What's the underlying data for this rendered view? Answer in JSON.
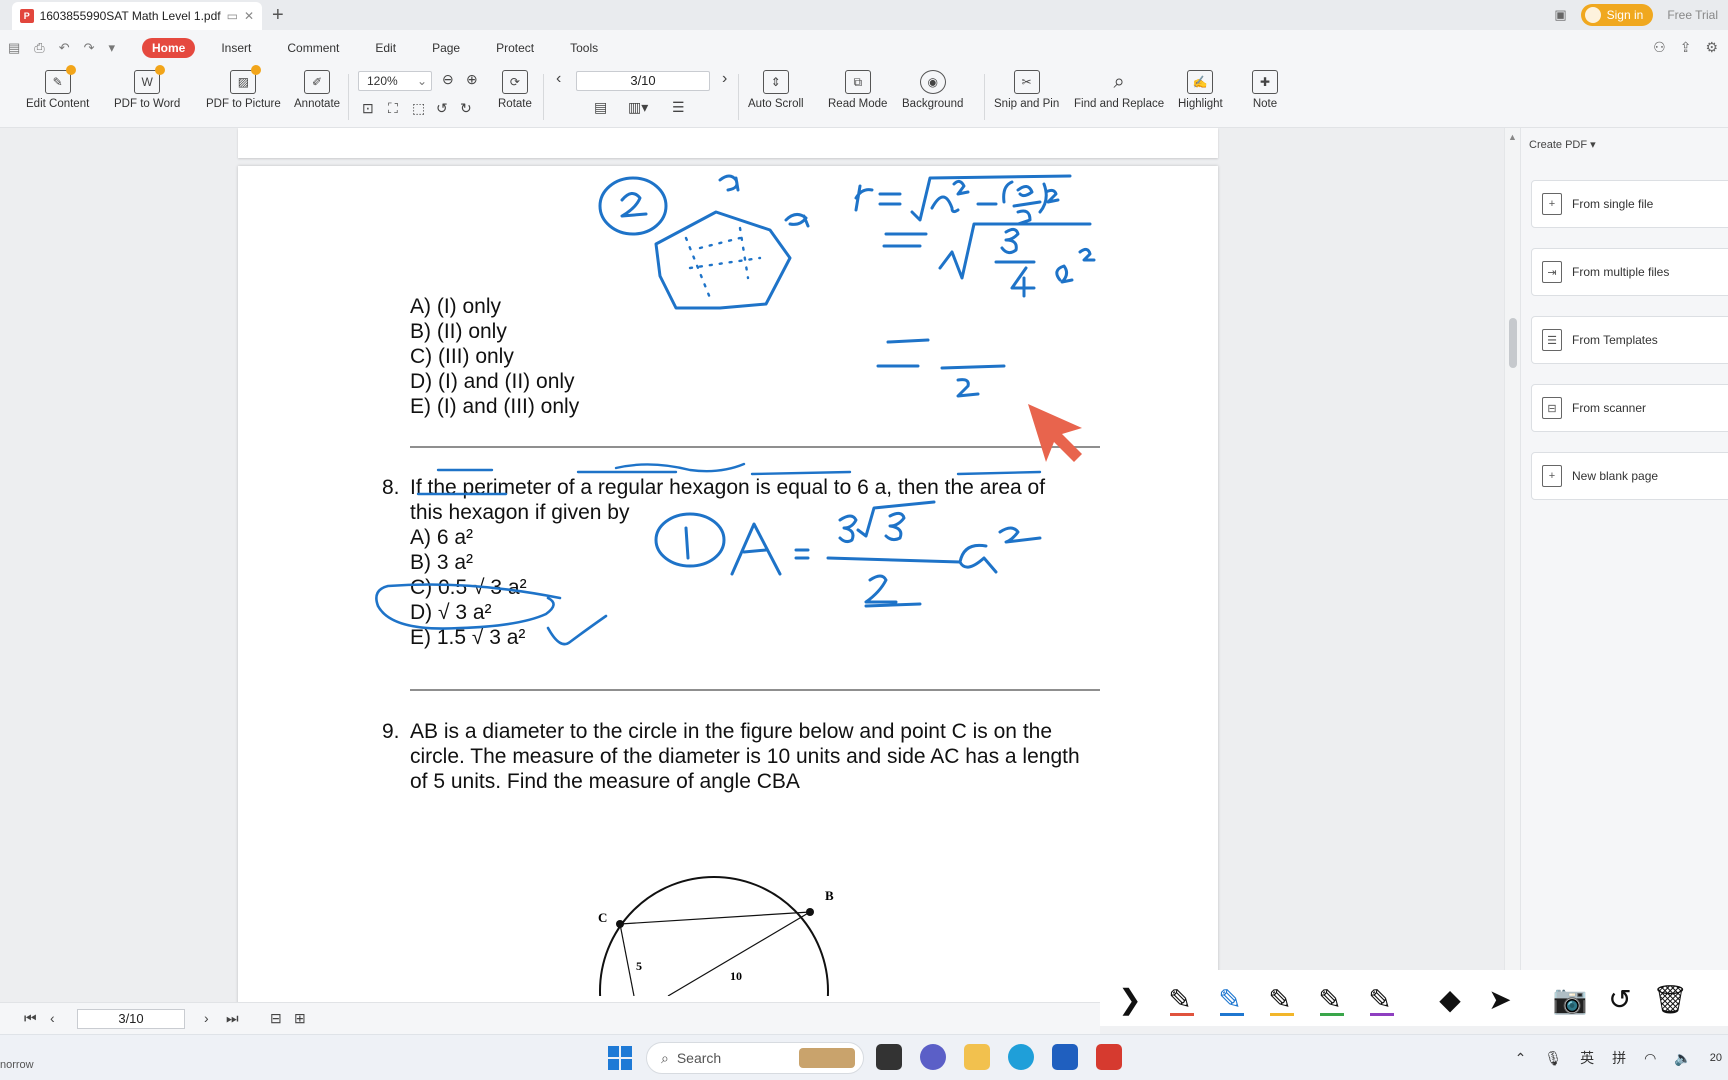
{
  "tab": {
    "title": "1603855990SAT Math Level 1.pdf",
    "new_tab": "+"
  },
  "titlebar": {
    "sign_in": "Sign in",
    "free_trial": "Free Trial"
  },
  "menu": [
    "Home",
    "Insert",
    "Comment",
    "Edit",
    "Page",
    "Protect",
    "Tools"
  ],
  "ribbon": {
    "edit_content": "Edit Content",
    "pdf_to_word": "PDF to Word",
    "pdf_to_picture": "PDF to Picture",
    "annotate": "Annotate",
    "zoom": "120%",
    "rotate": "Rotate",
    "page": "3/10",
    "auto_scroll": "Auto Scroll",
    "read_mode": "Read Mode",
    "background": "Background",
    "snip_and_pin": "Snip and Pin",
    "find_and_replace": "Find and Replace",
    "highlight": "Highlight",
    "note": "Note"
  },
  "doc": {
    "q7_options": [
      "A) (I) only",
      "B) (II) only",
      "C) (III) only",
      "D) (I) and (II) only",
      "E) (I) and (III) only"
    ],
    "q8_num": "8.",
    "q8_line1": "If the perimeter of a regular hexagon is equal to 6 a, then the area of",
    "q8_line2": "this hexagon if given by",
    "q8_options": [
      "A) 6 a²",
      "B) 3 a²",
      "C) 0.5 √ 3 a²",
      "D) √ 3 a²",
      "E) 1.5 √ 3 a²"
    ],
    "q9_num": "9.",
    "q9_lines": [
      "AB is a diameter to the circle in the figure below and point C is on the",
      "circle. The measure of the diameter is 10 units and side AC has a length",
      "of 5 units. Find the measure of angle CBA"
    ],
    "fig_labels": {
      "b": "B",
      "c": "C",
      "five": "5",
      "ten": "10"
    }
  },
  "right_panel": {
    "header": "Create PDF",
    "items": [
      "From single file",
      "From multiple files",
      "From Templates",
      "From scanner",
      "New blank page"
    ]
  },
  "bottom_nav": {
    "page": "3/10"
  },
  "pen_tools": {
    "colors": [
      "#e0533d",
      "#1f77d0",
      "#f2b62a",
      "#3aa64a",
      "#8e3fc0"
    ]
  },
  "taskbar": {
    "search": "Search",
    "left_text": "norrow",
    "ime1": "英",
    "ime2": "拼",
    "clock_partial": "20"
  }
}
